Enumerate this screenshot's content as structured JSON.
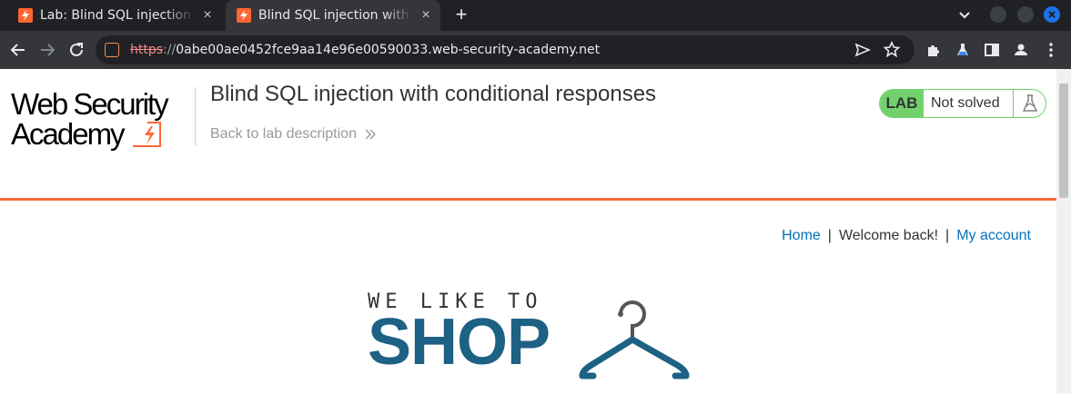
{
  "browser": {
    "tabs": [
      {
        "title": "Lab: Blind SQL injection with conditional responses",
        "active": false
      },
      {
        "title": "Blind SQL injection with conditional responses",
        "active": true
      }
    ],
    "new_tab_symbol": "+",
    "url": {
      "scheme": "https",
      "separator": "://",
      "host": "0abe00ae0452fce9aa14e96e00590033.web-security-academy.net"
    }
  },
  "academy": {
    "logo_line1": "Web Security",
    "logo_line2": "Academy",
    "lab_title": "Blind SQL injection with conditional responses",
    "back_link": "Back to lab description",
    "status_tag": "LAB",
    "status_text": "Not solved"
  },
  "nav": {
    "home": "Home",
    "welcome": "Welcome back!",
    "account": "My account",
    "separator": "|"
  },
  "shop_logo": {
    "line1": "WE LIKE TO",
    "line2": "SHOP"
  },
  "colors": {
    "brand_orange": "#ff6633",
    "lab_green": "#70d16d",
    "link_blue": "#0071bc",
    "shop_blue": "#1d6184"
  }
}
